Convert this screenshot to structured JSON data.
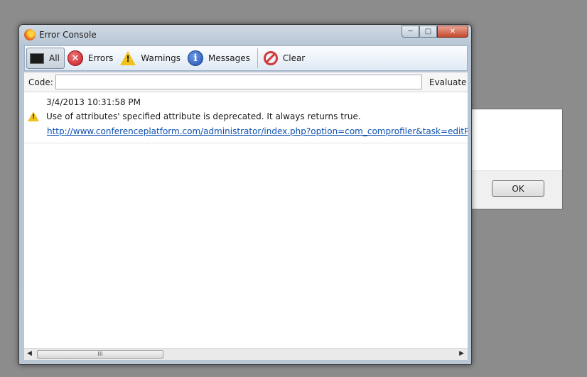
{
  "window": {
    "title": "Error Console"
  },
  "toolbar": {
    "buttons": [
      {
        "label": "All",
        "icon": "console-icon",
        "active": true
      },
      {
        "label": "Errors",
        "icon": "error-icon"
      },
      {
        "label": "Warnings",
        "icon": "warning-icon"
      },
      {
        "label": "Messages",
        "icon": "info-icon"
      },
      {
        "label": "Clear",
        "icon": "clear-icon"
      }
    ]
  },
  "code": {
    "label": "Code:",
    "value": "",
    "evaluate_label": "Evaluate"
  },
  "entries": [
    {
      "type": "warning",
      "timestamp": "3/4/2013 10:31:58 PM",
      "message": "Use of attributes' specified attribute is deprecated. It always returns true.",
      "source": "http://www.conferenceplatform.com/administrator/index.php?option=com_comprofiler&task=editPlugin&cid="
    }
  ],
  "scrollbar": {
    "thumb_grip": "III"
  },
  "background_dialog": {
    "ok_label": "OK"
  }
}
